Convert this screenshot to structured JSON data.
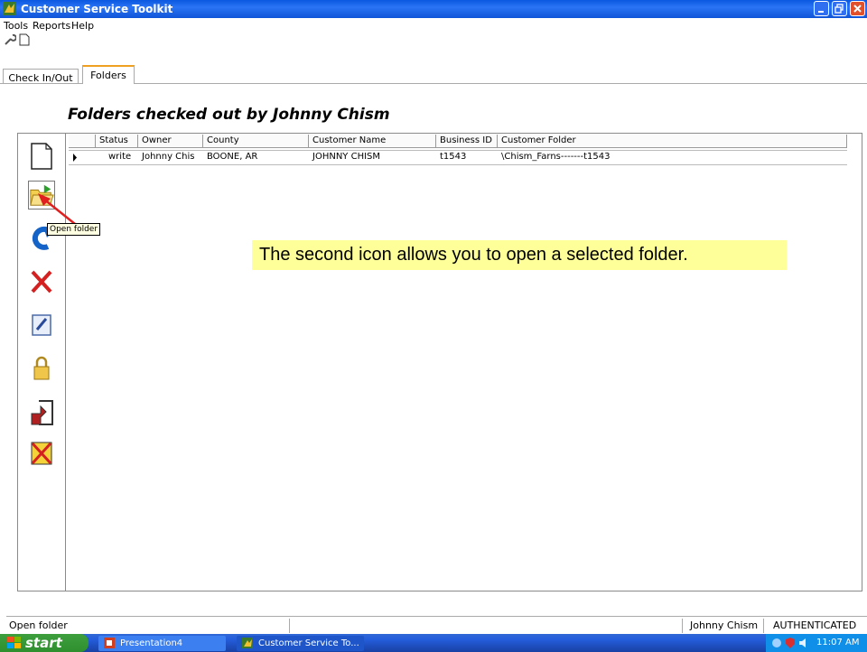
{
  "window": {
    "title": "Customer Service Toolkit"
  },
  "menu": [
    "Tools",
    "Reports",
    "Help"
  ],
  "toolbar": {
    "icons": [
      "wrench-icon",
      "new-document-icon"
    ]
  },
  "tabs": [
    {
      "label": "Check In/Out",
      "active": false
    },
    {
      "label": "Folders",
      "active": true
    }
  ],
  "heading": "Folders checked out by Johnny Chism",
  "grid": {
    "columns": [
      "Status",
      "Owner",
      "County",
      "Customer Name",
      "Business ID",
      "Customer Folder"
    ],
    "rows": [
      {
        "status": "write",
        "owner": "Johnny Chis",
        "county": "BOONE, AR",
        "customer_name": "JOHNNY CHISM",
        "business_id": "t1543",
        "customer_folder": "\\Chism_Farns-------t1543"
      }
    ]
  },
  "sidebar_icons": [
    "new-folder-icon",
    "open-folder-icon",
    "refresh-icon",
    "delete-icon",
    "edit-icon",
    "lock-icon",
    "checkin-icon",
    "cancel-icon"
  ],
  "tooltip": "Open folder",
  "callout": "The second icon allows you to open a selected folder.",
  "status": {
    "left": "Open folder",
    "user": "Johnny Chism",
    "auth": "AUTHENTICATED"
  },
  "taskbar": {
    "start": "start",
    "items": [
      "Presentation4",
      "Customer Service To..."
    ],
    "clock": "11:07 AM"
  },
  "colors": {
    "titlebar": "#0a58e0",
    "callout": "#ffff99",
    "tab_accent": "#f0a020"
  }
}
